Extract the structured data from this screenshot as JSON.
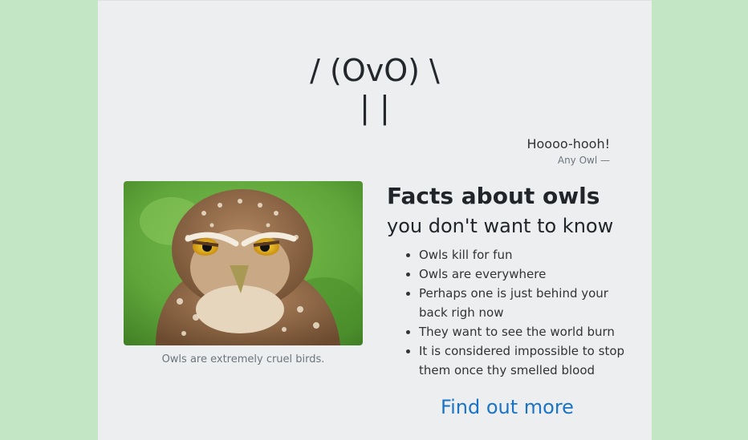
{
  "header": {
    "ascii_line1": "/ (OvO) \\",
    "ascii_line2": "| |"
  },
  "quote": {
    "text": "Hoooo-hooh!",
    "author": "Any Owl —"
  },
  "figure": {
    "image_icon": "owl-photo",
    "caption": "Owls are extremely cruel birds."
  },
  "facts": {
    "title_bold": "Facts about owls",
    "title_rest": " you don't want to know",
    "items": [
      "Owls kill for fun",
      "Owls are everywhere",
      "Perhaps one is just behind your back righ now",
      "They want to see the world burn",
      "It is considered impossible to stop them once thy smelled blood"
    ],
    "cta_label": "Find out more"
  },
  "colors": {
    "outer_background": "#c3e6c5",
    "page_background": "#eceef0",
    "link": "#1a73c4"
  }
}
